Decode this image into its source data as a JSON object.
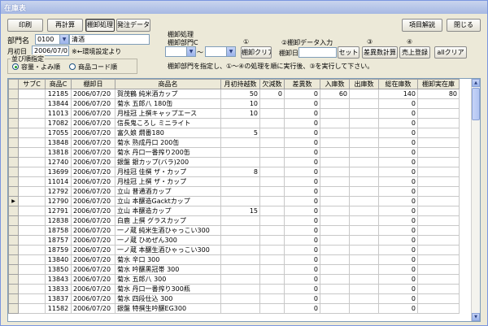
{
  "window": {
    "title": "在庫表"
  },
  "toolbar": {
    "print": "印刷",
    "recalc": "再計算",
    "stocktake": "棚卸処理",
    "order_data": "発注データ",
    "item_help": "項目解説",
    "close": "閉じる"
  },
  "filters": {
    "dept_label": "部門名",
    "dept_code": "0100",
    "dept_name": "清酒",
    "month_label": "月初日",
    "month_value": "2006/07/01",
    "month_note": "※←環境設定より",
    "sort_label": "並び順指定",
    "sort_option_1": "容量・よみ順",
    "sort_option_2": "商品コード順",
    "sort_selected": "容量・よみ順"
  },
  "stocktake": {
    "heading": "棚卸処理",
    "dept_label": "棚卸部門C",
    "tilde": "〜",
    "step1": "①",
    "step2": "②棚卸データ入力",
    "step3": "③",
    "step4": "④",
    "clear_btn": "棚卸クリア",
    "date_label": "棚卸日",
    "set_btn": "セット",
    "diff_btn": "差異数計算",
    "sales_btn": "売上登録",
    "all_clear_btn": "allクリア",
    "instructions": "棚卸部門を指定し、①〜④の処理を順に実行後、③を実行して下さい。"
  },
  "table": {
    "columns": [
      "サブC",
      "商品C",
      "棚卸日",
      "商品名",
      "月初持越数",
      "欠減数",
      "差異数",
      "入庫数",
      "出庫数",
      "総在庫数",
      "棚卸実在庫"
    ],
    "current_row": 11,
    "current_marker": "▶",
    "rows": [
      [
        "",
        "12185",
        "2006/07/20",
        "賀茂鶴 純米酒カップ",
        "50",
        "0",
        "0",
        "60",
        "",
        "140",
        "80"
      ],
      [
        "",
        "13844",
        "2006/07/20",
        "菊水 五郎八 180缶",
        "10",
        "",
        "0",
        "",
        "",
        "0",
        ""
      ],
      [
        "",
        "11013",
        "2006/07/20",
        "月桂冠 上撰キャップエース",
        "10",
        "",
        "0",
        "",
        "",
        "0",
        ""
      ],
      [
        "",
        "17082",
        "2006/07/20",
        "信長鬼ころし ミニライト",
        "",
        "",
        "0",
        "",
        "",
        "0",
        ""
      ],
      [
        "",
        "17055",
        "2006/07/20",
        "富久娘 燗番180",
        "5",
        "",
        "0",
        "",
        "",
        "0",
        ""
      ],
      [
        "",
        "13848",
        "2006/07/20",
        "菊水 熟成丹口 200缶",
        "",
        "",
        "0",
        "",
        "",
        "0",
        ""
      ],
      [
        "",
        "13818",
        "2006/07/20",
        "菊水 丹口一番搾り200缶",
        "",
        "",
        "0",
        "",
        "",
        "0",
        ""
      ],
      [
        "",
        "12740",
        "2006/07/20",
        "銀盤 銀カップ(バラ)200",
        "",
        "",
        "0",
        "",
        "",
        "0",
        ""
      ],
      [
        "",
        "13699",
        "2006/07/20",
        "月桂冠 佳撰 ザ・カップ",
        "8",
        "",
        "0",
        "",
        "",
        "0",
        ""
      ],
      [
        "",
        "11014",
        "2006/07/20",
        "月桂冠 上撰 ザ・カップ",
        "",
        "",
        "0",
        "",
        "",
        "0",
        ""
      ],
      [
        "",
        "12792",
        "2006/07/20",
        "立山 普通酒カップ",
        "",
        "",
        "0",
        "",
        "",
        "0",
        ""
      ],
      [
        "",
        "12790",
        "2006/07/20",
        "立山 本醸造Gacktカップ",
        "",
        "",
        "0",
        "",
        "",
        "0",
        ""
      ],
      [
        "",
        "12791",
        "2006/07/20",
        "立山 本醸造カップ",
        "15",
        "",
        "0",
        "",
        "",
        "0",
        ""
      ],
      [
        "",
        "12838",
        "2006/07/20",
        "白鹿 上撰 グラスカップ",
        "",
        "",
        "0",
        "",
        "",
        "0",
        ""
      ],
      [
        "",
        "18758",
        "2006/07/20",
        "一ノ蔵 純米生酒ひゃっこい300",
        "",
        "",
        "0",
        "",
        "",
        "0",
        ""
      ],
      [
        "",
        "18757",
        "2006/07/20",
        "一ノ蔵 ひめぜん300",
        "",
        "",
        "0",
        "",
        "",
        "0",
        ""
      ],
      [
        "",
        "18759",
        "2006/07/20",
        "一ノ蔵 本醸生酒ひゃっこい300",
        "",
        "",
        "0",
        "",
        "",
        "0",
        ""
      ],
      [
        "",
        "13840",
        "2006/07/20",
        "菊水 辛口 300",
        "",
        "",
        "0",
        "",
        "",
        "0",
        ""
      ],
      [
        "",
        "13850",
        "2006/07/20",
        "菊水 吟醸黒冠帯 300",
        "",
        "",
        "0",
        "",
        "",
        "0",
        ""
      ],
      [
        "",
        "13843",
        "2006/07/20",
        "菊水 五郎八 300",
        "",
        "",
        "0",
        "",
        "",
        "0",
        ""
      ],
      [
        "",
        "13833",
        "2006/07/20",
        "菊水 丹口一番搾り300瓶",
        "",
        "",
        "0",
        "",
        "",
        "0",
        ""
      ],
      [
        "",
        "13837",
        "2006/07/20",
        "菊水 四段仕込 300",
        "",
        "",
        "0",
        "",
        "",
        "0",
        ""
      ],
      [
        "",
        "11582",
        "2006/07/20",
        "銀盤 特撰生吟醸EG300",
        "",
        "",
        "0",
        "",
        "",
        "0",
        ""
      ]
    ]
  }
}
